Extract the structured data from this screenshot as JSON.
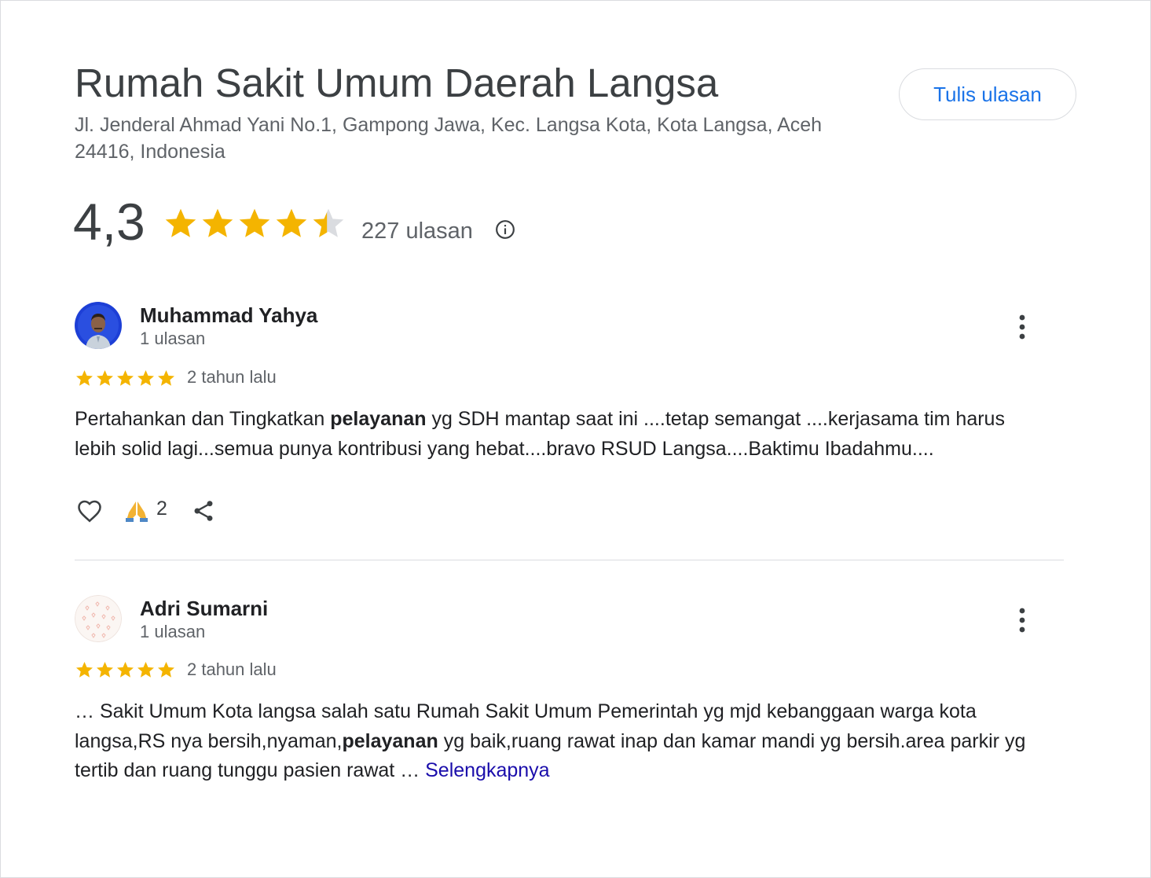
{
  "place": {
    "title": "Rumah Sakit Umum Daerah Langsa",
    "address": "Jl. Jenderal Ahmad Yani No.1, Gampong Jawa, Kec. Langsa Kota, Kota Langsa, Aceh 24416, Indonesia",
    "write_review_label": "Tulis ulasan"
  },
  "summary": {
    "rating": "4,3",
    "rating_value": 4.3,
    "review_count": "227 ulasan",
    "star_color": "#f4b400"
  },
  "reviews": [
    {
      "author": "Muhammad Yahya",
      "author_reviews": "1 ulasan",
      "stars": 5,
      "time": "2 tahun lalu",
      "text_parts": [
        "Pertahankan dan Tingkatkan ",
        "pelayanan",
        " yg SDH mantap saat ini ....tetap semangat ....kerjasama tim harus lebih solid lagi...semua punya kontribusi yang hebat....bravo RSUD Langsa....Baktimu Ibadahmu...."
      ],
      "reaction_count": "2"
    },
    {
      "author": "Adri Sumarni",
      "author_reviews": "1 ulasan",
      "stars": 5,
      "time": "2 tahun lalu",
      "text_parts": [
        "… Sakit Umum Kota langsa salah satu Rumah Sakit Umum Pemerintah yg mjd kebanggaan warga kota langsa,RS nya bersih,nyaman,",
        "pelayanan",
        " yg baik,ruang rawat inap dan kamar mandi yg bersih.area parkir yg tertib dan ruang tunggu pasien rawat … "
      ],
      "read_more": "Selengkapnya"
    }
  ]
}
